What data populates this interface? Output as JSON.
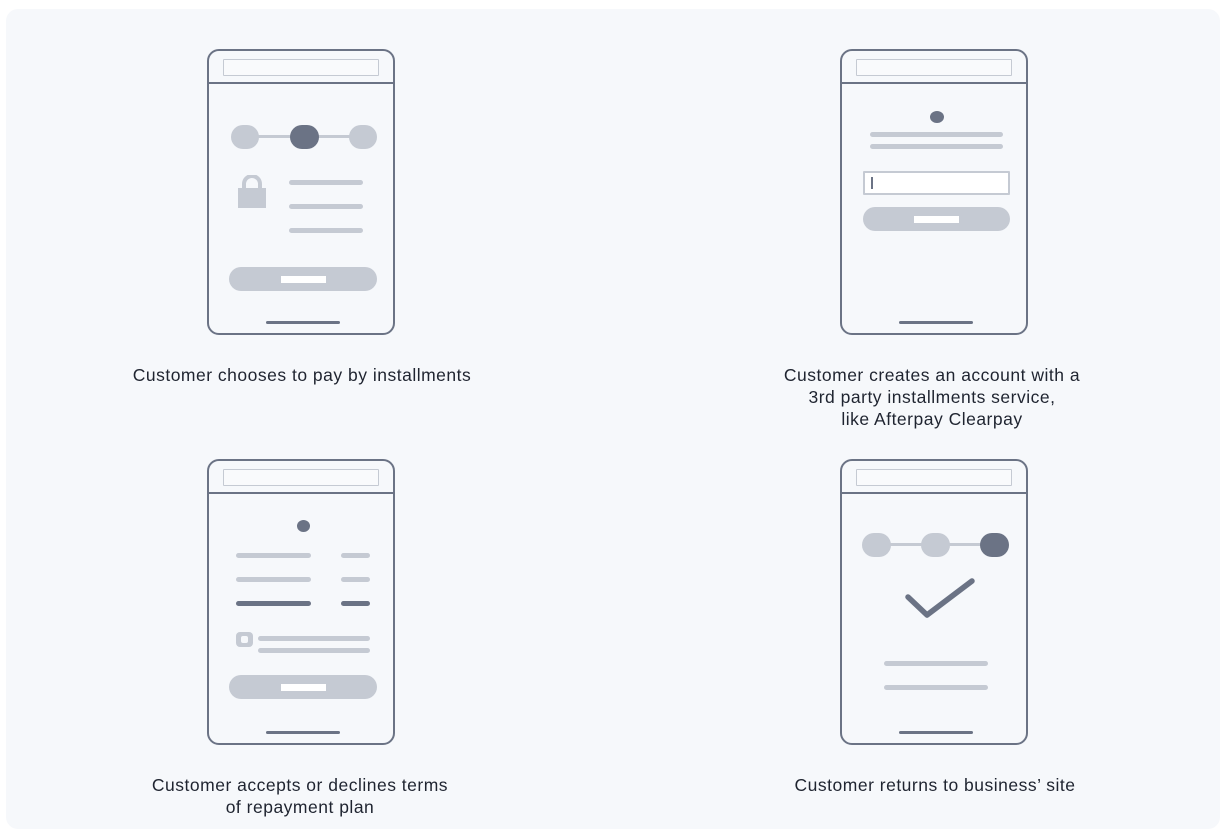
{
  "steps": [
    {
      "caption": "Customer chooses to pay by installments"
    },
    {
      "caption": "Customer creates an account with a\n3rd party installments service,\nlike Afterpay Clearpay"
    },
    {
      "caption": "Customer accepts or declines terms\nof repayment plan"
    },
    {
      "caption": "Customer returns to business’ site"
    }
  ],
  "icons": [
    "lock-icon",
    "text-cursor-icon",
    "checkbox-icon",
    "checkmark-icon"
  ],
  "colors": {
    "background": "#f6f8fb",
    "outline": "#6b7385",
    "placeholder": "#c5cad3",
    "text": "#1f2430"
  }
}
